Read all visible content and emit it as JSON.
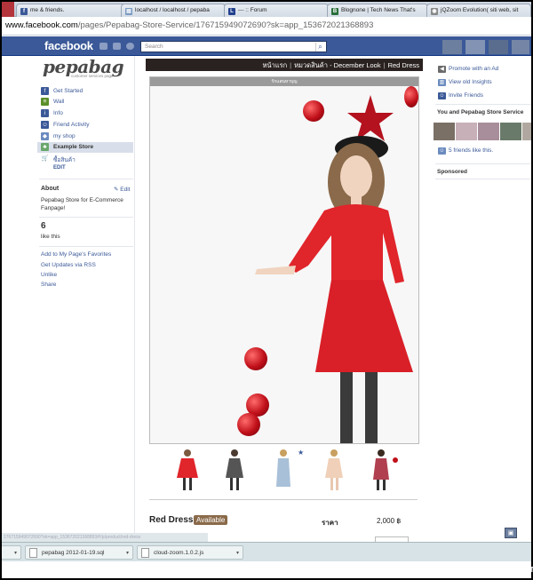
{
  "browser": {
    "tabs": [
      {
        "label": "me & friends.",
        "icon": "facebook-icon"
      },
      {
        "label": "localhost / localhost / pepaba",
        "icon": "database-icon"
      },
      {
        "label": "--- :: Forum",
        "icon": "forum-icon"
      },
      {
        "label": "Blognone | Tech News That's",
        "icon": "blognone-icon"
      },
      {
        "label": "jQZoom Evolution( siti web, sit",
        "icon": "globe-icon"
      }
    ],
    "address": {
      "host": "www.facebook.com",
      "path": "/pages/Pepabag-Store-Service/176715949072690?sk=app_153672021368893"
    },
    "status_url": "176715949072690?sk=app_153672021368893#!/p/product/red-dress",
    "downloads": [
      {
        "label": "pepabag 2012-01-19.sql"
      },
      {
        "label": "cloud-zoom.1.0.2.js"
      }
    ]
  },
  "facebook": {
    "logo": "facebook",
    "search_placeholder": "Search"
  },
  "left": {
    "page_logo": "pepabag",
    "page_logo_sub": "customer services page",
    "nav": [
      {
        "label": "Get Started",
        "icon": "facebook-f-icon",
        "color": "#3b5998"
      },
      {
        "label": "Wall",
        "icon": "wall-icon",
        "color": "#5a8f29"
      },
      {
        "label": "Info",
        "icon": "info-icon",
        "color": "#3b5998"
      },
      {
        "label": "Friend Activity",
        "icon": "friends-icon",
        "color": "#3b5998"
      },
      {
        "label": "my shop",
        "icon": "shop-icon",
        "color": "#6b8bbf"
      },
      {
        "label": "Example Store",
        "icon": "store-icon",
        "color": "#6aa66a",
        "active": true
      },
      {
        "label": "ซื้อสินค้า",
        "icon": "cart-icon",
        "color": "#6b8bbf"
      }
    ],
    "edit": "EDIT",
    "about_heading": "About",
    "about_edit": "Edit",
    "about_text": "Pepabag Store for E-Commerce Fanpage!",
    "likes_count": "6",
    "likes_label": "like this",
    "links": [
      "Add to My Page's Favorites",
      "Get Updates via RSS",
      "Unlike",
      "Share"
    ]
  },
  "store": {
    "breadcrumb": [
      "หน้าแรก",
      "หมวดสินค้า - December Look",
      "Red Dress"
    ],
    "image_caption": "รักแสนหาบุญ",
    "product_name": "Red Dress",
    "product_status": "Available",
    "price_label": "ราคา",
    "price_value": "2,000 ฿"
  },
  "right": {
    "links": [
      {
        "label": "Promote with an Ad",
        "icon": "megaphone-icon"
      },
      {
        "label": "View old Insights",
        "icon": "insights-icon"
      },
      {
        "label": "Invite Friends",
        "icon": "invite-friends-icon"
      }
    ],
    "friends_heading": "You and Pepabag Store Service",
    "friends_like": "5 friends like this.",
    "sponsored": "Sponsored"
  },
  "watermark": "[991x1050] https://upic.me/"
}
